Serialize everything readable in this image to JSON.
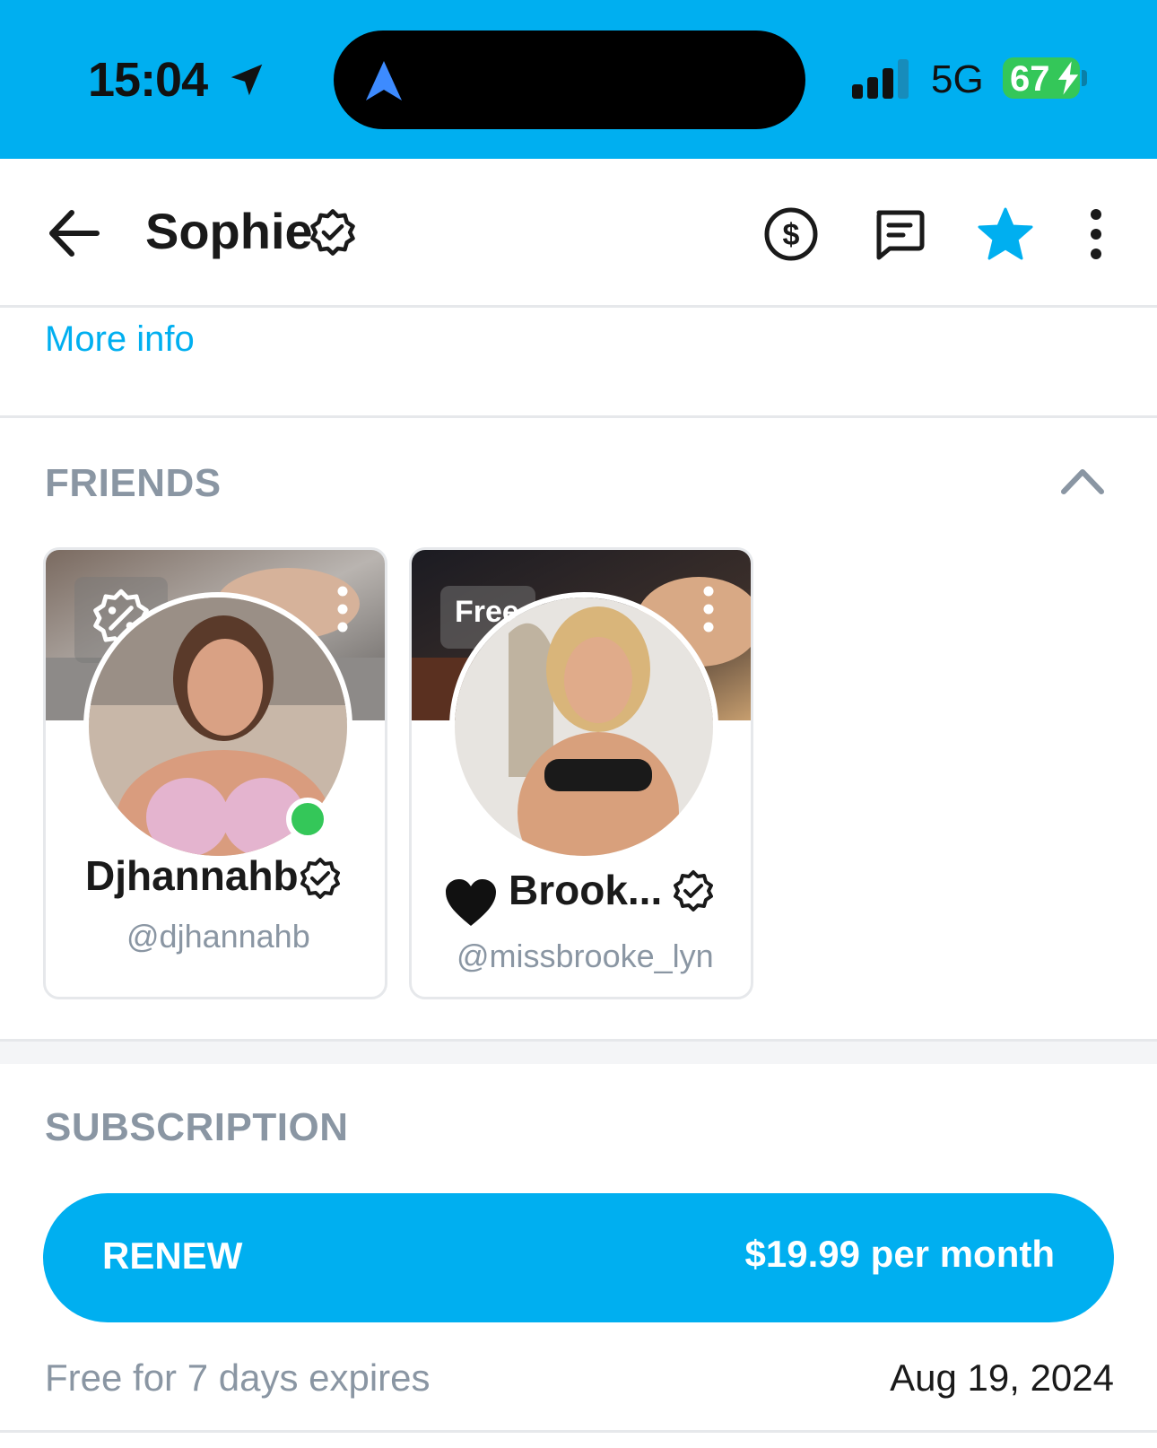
{
  "status_bar": {
    "time": "15:04",
    "network": "5G",
    "battery": "67"
  },
  "header": {
    "title": "Sophie",
    "icons": [
      "back-arrow-icon",
      "tip-dollar-icon",
      "message-icon",
      "star-icon",
      "more-vertical-icon"
    ]
  },
  "more_info_label": "More info",
  "friends": {
    "title": "FRIENDS",
    "cards": [
      {
        "name": "Djhannahb",
        "handle": "@djhannahb",
        "badge_icon": "discount-icon",
        "online": true
      },
      {
        "name": "Brook...",
        "handle": "@missbrooke_lyn",
        "badge": "Free",
        "prefix_icon": "black-heart-icon",
        "online": false
      }
    ]
  },
  "subscription": {
    "title": "SUBSCRIPTION",
    "button_label": "RENEW",
    "price": "$19.99 per month",
    "note": "Free for 7 days expires",
    "expiry_date": "Aug 19, 2024"
  },
  "colors": {
    "accent": "#00aff0",
    "muted": "#8a96a3",
    "online": "#34c759"
  }
}
